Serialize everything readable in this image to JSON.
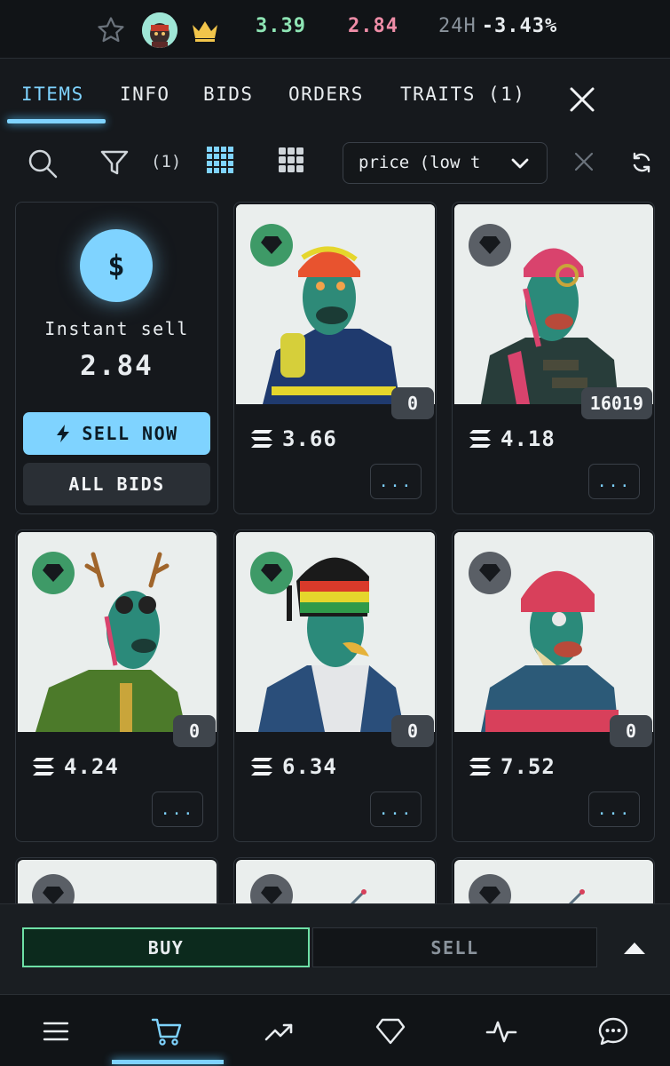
{
  "stats": {
    "floor": "3.39",
    "top_bid": "2.84",
    "change_label": "24H",
    "change_value": "-3.43%"
  },
  "tabs": [
    {
      "label": "ITEMS",
      "active": true
    },
    {
      "label": "INFO"
    },
    {
      "label": "BIDS"
    },
    {
      "label": "ORDERS"
    },
    {
      "label": "TRAITS (1)"
    }
  ],
  "toolbar": {
    "filter_count": "(1)",
    "sort_value": "price (low t"
  },
  "instant_sell": {
    "icon": "$",
    "label": "Instant sell",
    "value": "2.84",
    "sell_now_label": "SELL NOW",
    "all_bids_label": "ALL BIDS"
  },
  "items": [
    {
      "price": "3.66",
      "rank": "0",
      "gem": "green",
      "colors": {
        "bg": "#eaeeed",
        "hat": "#e8532f",
        "body": "#1f3a6e",
        "face": "#2e8a78"
      }
    },
    {
      "price": "4.18",
      "rank": "16019",
      "gem": "gray",
      "colors": {
        "bg": "#eaeeed",
        "hat": "#d9436d",
        "body": "#283d3a",
        "face": "#2b8a7a"
      }
    },
    {
      "price": "4.24",
      "rank": "0",
      "gem": "green",
      "colors": {
        "bg": "#eaeeed",
        "hat": "#a0652b",
        "body": "#4c7a2a",
        "face": "#2b8a7a"
      }
    },
    {
      "price": "6.34",
      "rank": "0",
      "gem": "green",
      "colors": {
        "bg": "#eaeeed",
        "hat": "#d8c22c",
        "body": "#2a4e7a",
        "face": "#2b8a7a"
      }
    },
    {
      "price": "7.52",
      "rank": "0",
      "gem": "gray",
      "colors": {
        "bg": "#eaeeed",
        "hat": "#d8405b",
        "body": "#2c5a78",
        "face": "#2b8a7a"
      }
    }
  ],
  "more_label": "...",
  "trade": {
    "buy_label": "BUY",
    "sell_label": "SELL"
  }
}
